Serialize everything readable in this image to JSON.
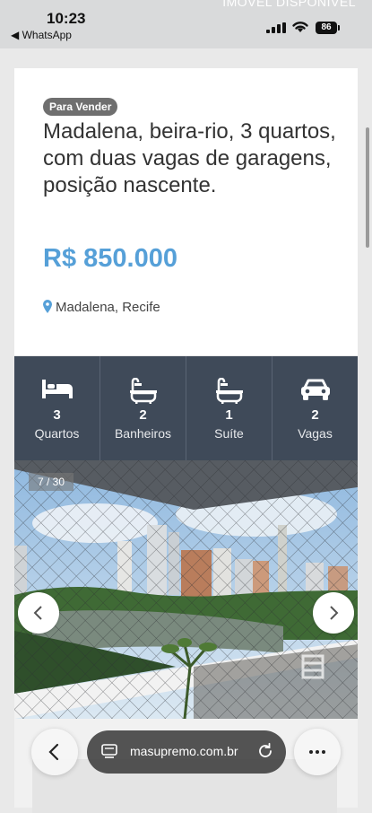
{
  "status": {
    "time": "10:23",
    "back_app": "◀ WhatsApp",
    "battery": "86",
    "background_text": "IMÓVEL DISPONÍVEL"
  },
  "listing": {
    "badge": "Para Vender",
    "title": "Madalena, beira-rio, 3 quartos, com duas vagas de garagens, posição nascente.",
    "price": "R$ 850.000",
    "location": "Madalena, Recife"
  },
  "features": [
    {
      "icon": "bed-icon",
      "count": "3",
      "label": "Quartos"
    },
    {
      "icon": "bathtub-icon",
      "count": "2",
      "label": "Banheiros"
    },
    {
      "icon": "bathtub-icon",
      "count": "1",
      "label": "Suíte"
    },
    {
      "icon": "car-icon",
      "count": "2",
      "label": "Vagas"
    }
  ],
  "gallery": {
    "counter": "7 / 30"
  },
  "browser": {
    "url": "masupremo.com.br"
  },
  "colors": {
    "price": "#56a0d8",
    "features_bg": "#3f4a59",
    "badge_bg": "#6f6f6f"
  }
}
